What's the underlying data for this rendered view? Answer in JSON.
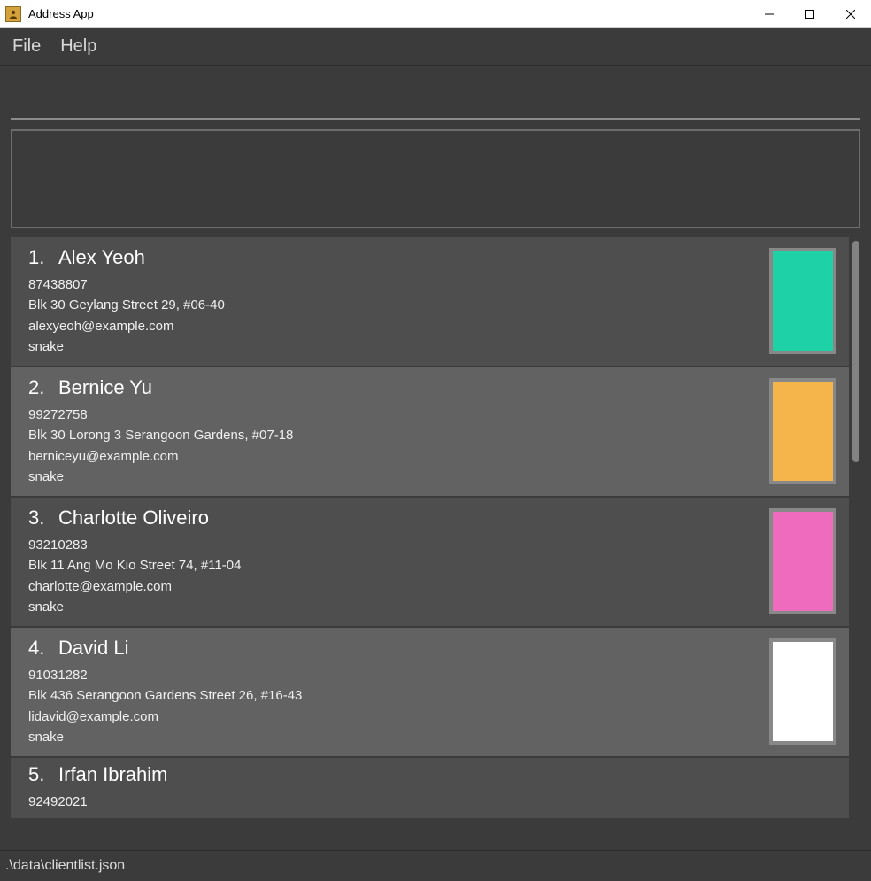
{
  "window": {
    "title": "Address App"
  },
  "menu": {
    "file": "File",
    "help": "Help"
  },
  "contacts": [
    {
      "index": "1.",
      "name": "Alex Yeoh",
      "phone": "87438807",
      "address": "Blk 30 Geylang Street 29, #06-40",
      "email": "alexyeoh@example.com",
      "tag": "snake",
      "color": "#1fd1a7"
    },
    {
      "index": "2.",
      "name": "Bernice Yu",
      "phone": "99272758",
      "address": "Blk 30 Lorong 3 Serangoon Gardens, #07-18",
      "email": "berniceyu@example.com",
      "tag": "snake",
      "color": "#f5b54a"
    },
    {
      "index": "3.",
      "name": "Charlotte Oliveiro",
      "phone": "93210283",
      "address": "Blk 11 Ang Mo Kio Street 74, #11-04",
      "email": "charlotte@example.com",
      "tag": "snake",
      "color": "#ee6bbd"
    },
    {
      "index": "4.",
      "name": "David Li",
      "phone": "91031282",
      "address": "Blk 436 Serangoon Gardens Street 26, #16-43",
      "email": "lidavid@example.com",
      "tag": "snake",
      "color": "#ffffff"
    },
    {
      "index": "5.",
      "name": "Irfan Ibrahim",
      "phone": "92492021",
      "address": "",
      "email": "",
      "tag": "",
      "color": ""
    }
  ],
  "statusbar": {
    "path": ".\\data\\clientlist.json"
  }
}
